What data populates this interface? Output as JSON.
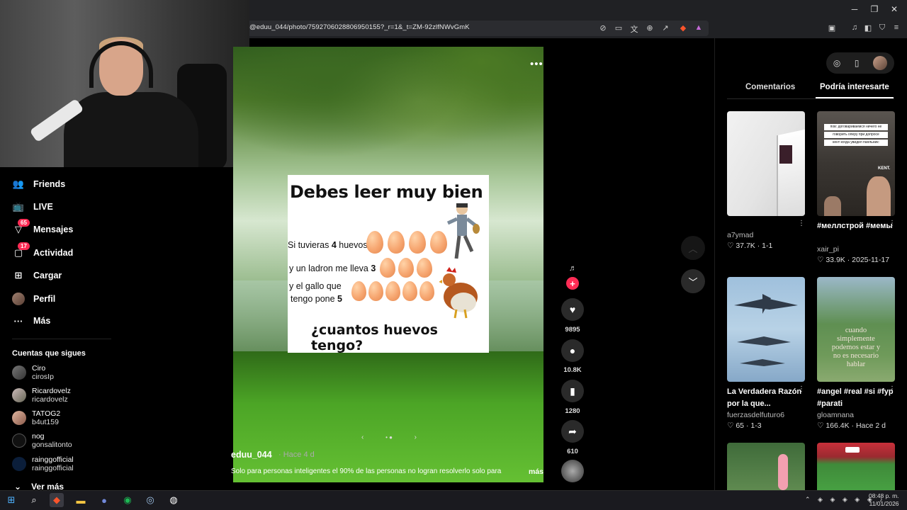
{
  "browser": {
    "url": "@eduu_044/photo/7592706028806950155?_r=1&_t=ZM-92zlfNWvGmK",
    "window_controls": {
      "minimize": "─",
      "maximize": "❐",
      "close": "✕"
    }
  },
  "sidebar": {
    "nav": [
      {
        "label": "Friends",
        "icon": "friends-icon",
        "badge": ""
      },
      {
        "label": "LIVE",
        "icon": "live-icon",
        "badge": ""
      },
      {
        "label": "Mensajes",
        "icon": "messages-icon",
        "badge": "65"
      },
      {
        "label": "Actividad",
        "icon": "activity-icon",
        "badge": "17"
      },
      {
        "label": "Cargar",
        "icon": "upload-icon",
        "badge": ""
      },
      {
        "label": "Perfil",
        "icon": "profile-avatar",
        "badge": ""
      },
      {
        "label": "Más",
        "icon": "more-icon",
        "badge": ""
      }
    ],
    "following_title": "Cuentas que sigues",
    "following": [
      {
        "name": "Ciro",
        "username": "cirosIp"
      },
      {
        "name": "Ricardovelz",
        "username": "ricardovelz"
      },
      {
        "name": "TATOG2",
        "username": "b4ut159"
      },
      {
        "name": "nog",
        "username": "gonsalitonto"
      },
      {
        "name": "rainggofficial",
        "username": "rainggofficial"
      }
    ],
    "see_more": "Ver más"
  },
  "post": {
    "puzzle": {
      "title": "Debes leer muy bien",
      "line1_prefix": "Si tuvieras ",
      "line1_num": "4",
      "line1_suffix": " huevos",
      "line2_prefix": "y un ladron me lleva ",
      "line2_num": "3",
      "line3a": "y el gallo que",
      "line3b_prefix": "tengo pone ",
      "line3b_num": "5",
      "question": "¿cuantos huevos tengo?"
    },
    "author": "eduu_044",
    "posted": "· Hace 4 d",
    "caption": "Solo para personas inteligentes el 90% de las personas no logran resolverlo solo para",
    "more": "más",
    "counts": {
      "likes": "9895",
      "comments": "10.8K",
      "saves": "1280",
      "shares": "610"
    }
  },
  "right_panel": {
    "tabs": [
      "Comentarios",
      "Podría interesarte"
    ],
    "active_tab": "Podría interesarte",
    "cards": [
      {
        "title": "",
        "user": "a7ymad",
        "likes": "37.7K",
        "date": "1-1"
      },
      {
        "title": "#меллстрой #мемы",
        "user": "xair_pi",
        "likes": "33.9K",
        "date": "2025-11-17",
        "overlay_lines": [
          "пов: договариваемся ничего не",
          "говорить опеpу при допросе",
          "кент когда увидел паяльник:"
        ],
        "overlay_tag": "KENT."
      },
      {
        "title": "La Verdadera Razón por la que...",
        "user": "fuerzasdelfuturo6",
        "likes": "65",
        "date": "1-3"
      },
      {
        "title": "#angel #real #si #fyp #parati",
        "user": "gloamnana",
        "likes": "166.4K",
        "date": "Hace 2 d",
        "overlay_lines": [
          "cuando",
          "simplemente",
          "podemos estar y",
          "no es necesario",
          "hablar"
        ]
      }
    ]
  },
  "taskbar": {
    "time": "08:48 p. m.",
    "date": "11/01/2026"
  }
}
